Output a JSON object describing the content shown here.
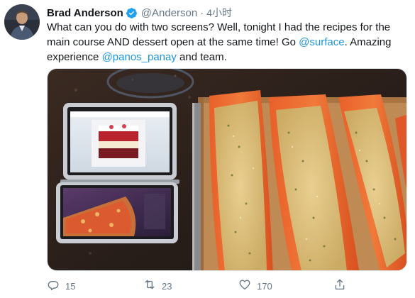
{
  "tweet": {
    "author": {
      "display_name": "Brad Anderson",
      "handle": "@Anderson",
      "verified": true
    },
    "separator": "·",
    "time": "4小时",
    "text": {
      "part1": "What can you do with two screens?  Well, tonight I had the recipes for the main course AND dessert open at the same time! Go ",
      "mention_surface": "@surface",
      "part2": ". Amazing experience ",
      "mention_panos": "@panos_panay",
      "part3": " and team."
    },
    "media": {
      "description_icon": "photo"
    },
    "actions": {
      "reply": {
        "icon": "reply-icon",
        "count": "15"
      },
      "retweet": {
        "icon": "retweet-icon",
        "count": "23"
      },
      "like": {
        "icon": "heart-icon",
        "count": "170"
      },
      "share": {
        "icon": "share-icon"
      }
    },
    "colors": {
      "link": "#1b95e0",
      "secondary": "#657786",
      "verified": "#1da1f2"
    }
  }
}
